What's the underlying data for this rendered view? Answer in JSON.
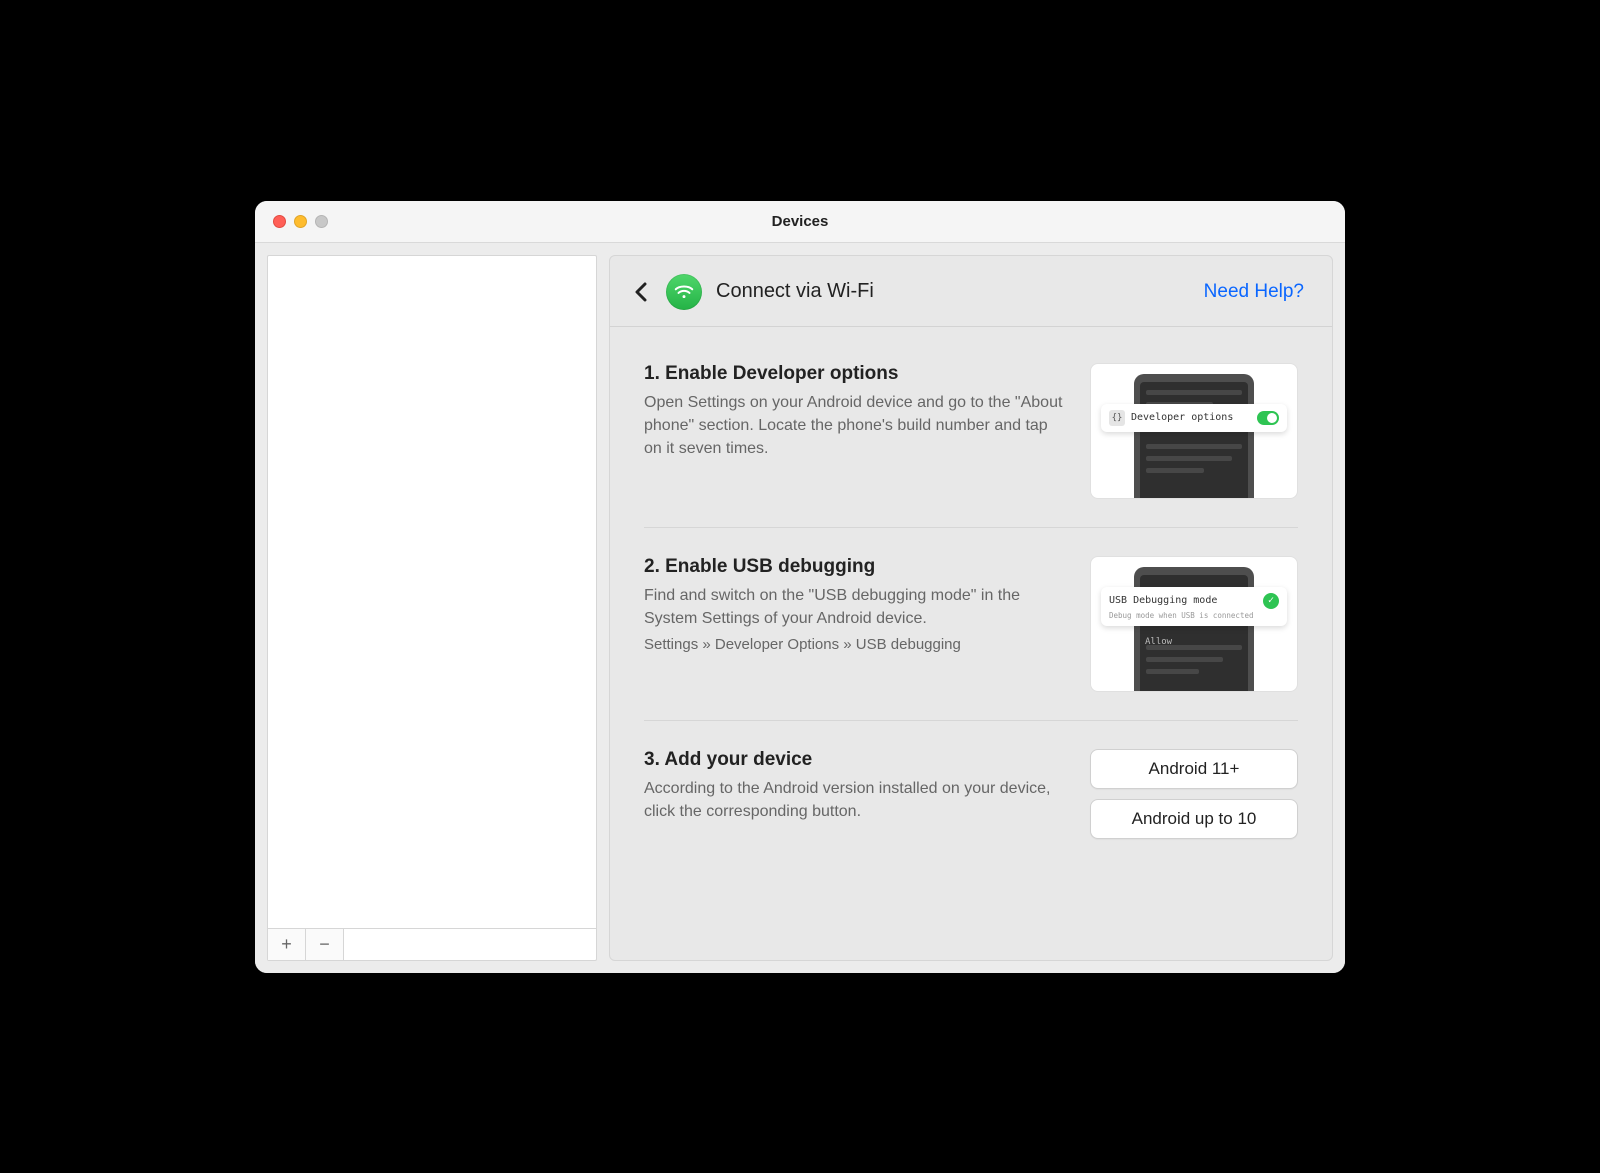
{
  "window": {
    "title": "Devices"
  },
  "header": {
    "title": "Connect via Wi-Fi",
    "help_link": "Need Help?"
  },
  "steps": {
    "s1": {
      "title": "1. Enable Developer options",
      "desc": "Open Settings on your Android device and go to the \"About phone\" section. Locate the phone's build number and tap on it seven times.",
      "callout_label": "Developer options"
    },
    "s2": {
      "title": "2. Enable USB debugging",
      "desc": "Find and switch on the \"USB debugging mode\" in the System Settings of your Android device.",
      "path": "Settings » Developer Options » USB debugging",
      "callout_label": "USB Debugging mode",
      "callout_sub": "Debug mode when USB is connected",
      "allow": "Allow"
    },
    "s3": {
      "title": "3. Add your device",
      "desc": "According to the Android version installed on your device, click the corresponding button.",
      "btn1": "Android 11+",
      "btn2": "Android up to 10"
    }
  },
  "sidebar_buttons": {
    "add": "+",
    "remove": "−"
  }
}
